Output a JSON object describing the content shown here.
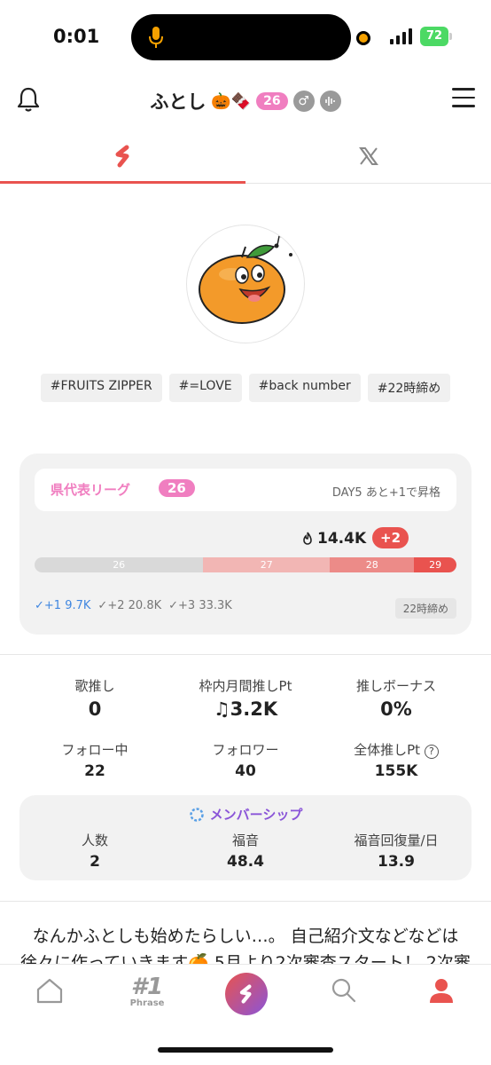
{
  "status_bar": {
    "time": "0:01",
    "battery": "72"
  },
  "header": {
    "username": "ふとし",
    "emoji": "🎃🍫",
    "level_badge": "26",
    "gender_icon": "male-icon",
    "voice_icon": "voice-wave-icon"
  },
  "tabs": [
    {
      "name": "app-logo-tab",
      "active": true
    },
    {
      "name": "x-tab",
      "active": false
    }
  ],
  "tags": [
    "#FRUITS ZIPPER",
    "#=LOVE",
    "#back number",
    "#22時締め"
  ],
  "league": {
    "name": "県代表リーグ",
    "level": "26",
    "day_note": "DAY5 あと+1で昇格",
    "points": "14.4K",
    "points_change": "+2",
    "ranks": [
      {
        "label": "26",
        "color": "#d9d9d9",
        "share": 0.4
      },
      {
        "label": "27",
        "color": "#f2b6b4",
        "share": 0.3
      },
      {
        "label": "28",
        "color": "#ec8b88",
        "share": 0.2
      },
      {
        "label": "29",
        "color": "#e9534f",
        "share": 0.1
      }
    ],
    "thresholds": [
      {
        "label": "+1",
        "value": "9.7K"
      },
      {
        "label": "+2",
        "value": "20.8K"
      },
      {
        "label": "+3",
        "value": "33.3K"
      }
    ],
    "deadline": "22時締め"
  },
  "stats": {
    "song_oshi_label": "歌推し",
    "song_oshi_value": "0",
    "monthly_pt_label": "枠内月間推しPt",
    "monthly_pt_value": "3.2K",
    "bonus_label": "推しボーナス",
    "bonus_value": "0%",
    "following_label": "フォロー中",
    "following_value": "22",
    "followers_label": "フォロワー",
    "followers_value": "40",
    "total_pt_label": "全体推しPt",
    "total_pt_value": "155K"
  },
  "membership": {
    "title": "メンバーシップ",
    "count_label": "人数",
    "count_value": "2",
    "fukuon_label": "福音",
    "fukuon_value": "48.4",
    "recovery_label": "福音回復量/日",
    "recovery_value": "13.9"
  },
  "bio": "なんかふとしも始めたらしい…。 自己紹介文などなどは徐々に作っていきます🍊 5月より2次審査スタート！ 2次審",
  "nav": {
    "phrase_num": "#1",
    "phrase_label": "Phrase"
  }
}
